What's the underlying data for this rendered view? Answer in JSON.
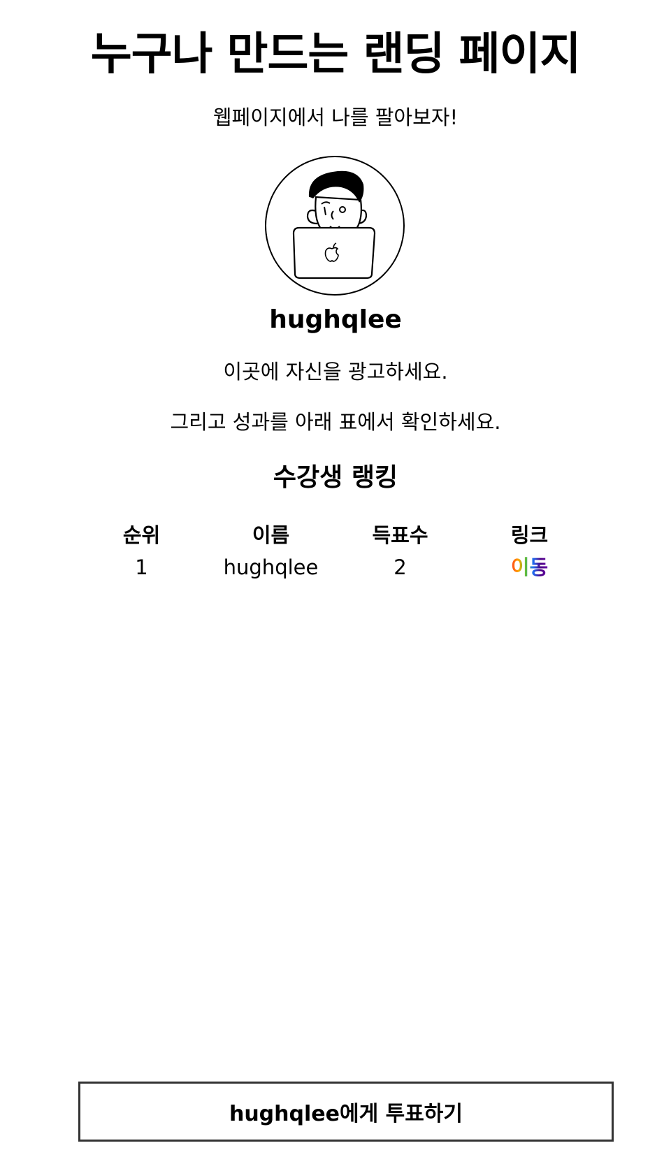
{
  "header": {
    "title": "누구나 만드는 랜딩 페이지",
    "subtitle": "웹페이지에서 나를 팔아보자!"
  },
  "profile": {
    "avatar_icon": "developer-with-laptop-illustration",
    "username": "hughqlee",
    "description_1": "이곳에 자신을 광고하세요.",
    "description_2": "그리고 성과를 아래 표에서 확인하세요."
  },
  "ranking": {
    "title": "수강생 랭킹",
    "columns": [
      "순위",
      "이름",
      "득표수",
      "링크"
    ],
    "rows": [
      {
        "rank": "1",
        "name": "hughqlee",
        "votes": "2",
        "link_label": "이동"
      }
    ],
    "link_gradient": [
      "#ff3b1f",
      "#ffa500",
      "#5fbf3a",
      "#1e6cf5",
      "#4b0082",
      "#6a0dad"
    ]
  },
  "vote": {
    "button_label": "hughqlee에게 투표하기"
  }
}
